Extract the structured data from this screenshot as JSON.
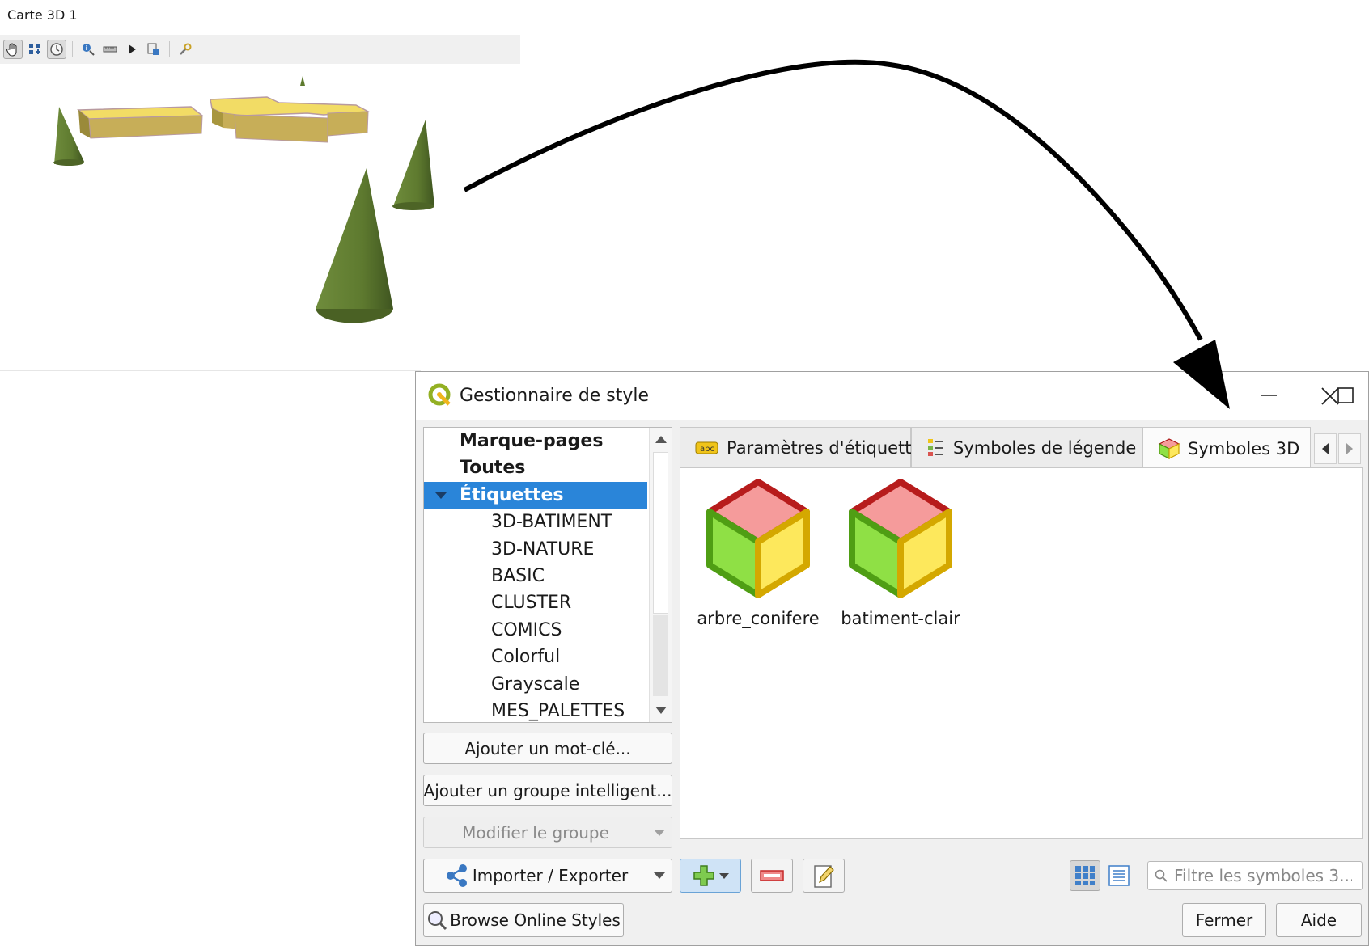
{
  "map_window": {
    "title": "Carte 3D 1",
    "toolbar_icons": [
      "pan-icon",
      "camera-tile-icon",
      "animation-icon",
      "identify-icon",
      "measure-icon",
      "play-icon",
      "export-scene-icon",
      "config-icon"
    ]
  },
  "dialog": {
    "title": "Gestionnaire de style",
    "tree": {
      "items": [
        {
          "label": "Marque-pages",
          "kind": "root"
        },
        {
          "label": "Toutes",
          "kind": "root"
        },
        {
          "label": "Étiquettes",
          "kind": "group",
          "selected": true
        },
        {
          "label": "3D-BATIMENT",
          "kind": "child"
        },
        {
          "label": "3D-NATURE",
          "kind": "child"
        },
        {
          "label": "BASIC",
          "kind": "child"
        },
        {
          "label": "CLUSTER",
          "kind": "child"
        },
        {
          "label": "COMICS",
          "kind": "child"
        },
        {
          "label": "Colorful",
          "kind": "child"
        },
        {
          "label": "Grayscale",
          "kind": "child"
        },
        {
          "label": "MES_PALETTES",
          "kind": "child"
        }
      ]
    },
    "buttons": {
      "add_tag": "Ajouter un mot-clé...",
      "add_smart_group": "Ajouter un groupe intelligent...",
      "modify_group": "Modifier le groupe",
      "import_export": "Importer / Exporter",
      "browse_online": "Browse Online Styles",
      "close": "Fermer",
      "help": "Aide"
    },
    "tabs": [
      {
        "label": "Paramètres d'étiquette",
        "icon": "label-settings-icon"
      },
      {
        "label": "Symboles de légende",
        "icon": "legend-symbols-icon"
      },
      {
        "label": "Symboles 3D",
        "icon": "cube-3d-icon",
        "active": true
      }
    ],
    "symbols": [
      {
        "label": "arbre_conifere",
        "icon": "cube-3d-icon"
      },
      {
        "label": "batiment-clair",
        "icon": "cube-3d-icon"
      }
    ],
    "filter": {
      "placeholder": "Filtre les symboles 3..."
    },
    "colors": {
      "selection": "#2a85d9",
      "cube_top": "#f59b9b",
      "cube_left": "#8fe045",
      "cube_right": "#fde85c",
      "foliage": "#5c7a32",
      "building": "#c9b45a"
    }
  }
}
